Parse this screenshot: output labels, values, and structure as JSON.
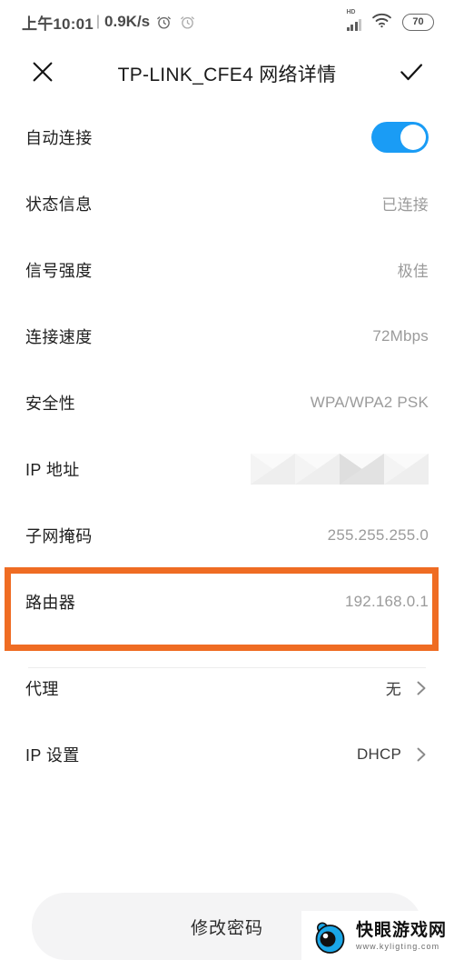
{
  "statusbar": {
    "time": "上午10:01",
    "separator": "|",
    "net_rate": "0.9K/s",
    "alarm_icon_1": "alarm-clock-icon",
    "alarm_icon_2": "alarm-clock-icon",
    "hd_badge": "HD",
    "signal_icon": "cellular-signal-icon",
    "wifi_icon": "wifi-icon",
    "battery_level": "70"
  },
  "appbar": {
    "close_icon": "close-icon",
    "title": "TP-LINK_CFE4 网络详情",
    "confirm_icon": "check-icon"
  },
  "rows": [
    {
      "label": "自动连接",
      "value": "",
      "type": "toggle",
      "toggle_on": true
    },
    {
      "label": "状态信息",
      "value": "已连接",
      "type": "value"
    },
    {
      "label": "信号强度",
      "value": "极佳",
      "type": "value"
    },
    {
      "label": "连接速度",
      "value": "72Mbps",
      "type": "value"
    },
    {
      "label": "安全性",
      "value": "WPA/WPA2 PSK",
      "type": "value"
    },
    {
      "label": "IP 地址",
      "value": "",
      "type": "masked"
    },
    {
      "label": "子网掩码",
      "value": "255.255.255.0",
      "type": "value"
    },
    {
      "label": "路由器",
      "value": "192.168.0.1",
      "type": "value",
      "highlighted": true
    },
    {
      "label": "代理",
      "value": "无",
      "type": "nav",
      "chevron": "chevron-right-icon"
    },
    {
      "label": "IP 设置",
      "value": "DHCP",
      "type": "nav",
      "chevron": "chevron-right-icon"
    }
  ],
  "bottom_button": {
    "label": "修改密码"
  },
  "watermark": {
    "name": "快眼游戏网",
    "url": "www.kyligting.com"
  },
  "colors": {
    "accent_toggle": "#1A9CF5",
    "highlight_border": "#EF6C23",
    "label_text": "#1F1F1F",
    "value_text": "#9B9B9B",
    "button_bg": "#F4F4F5"
  }
}
